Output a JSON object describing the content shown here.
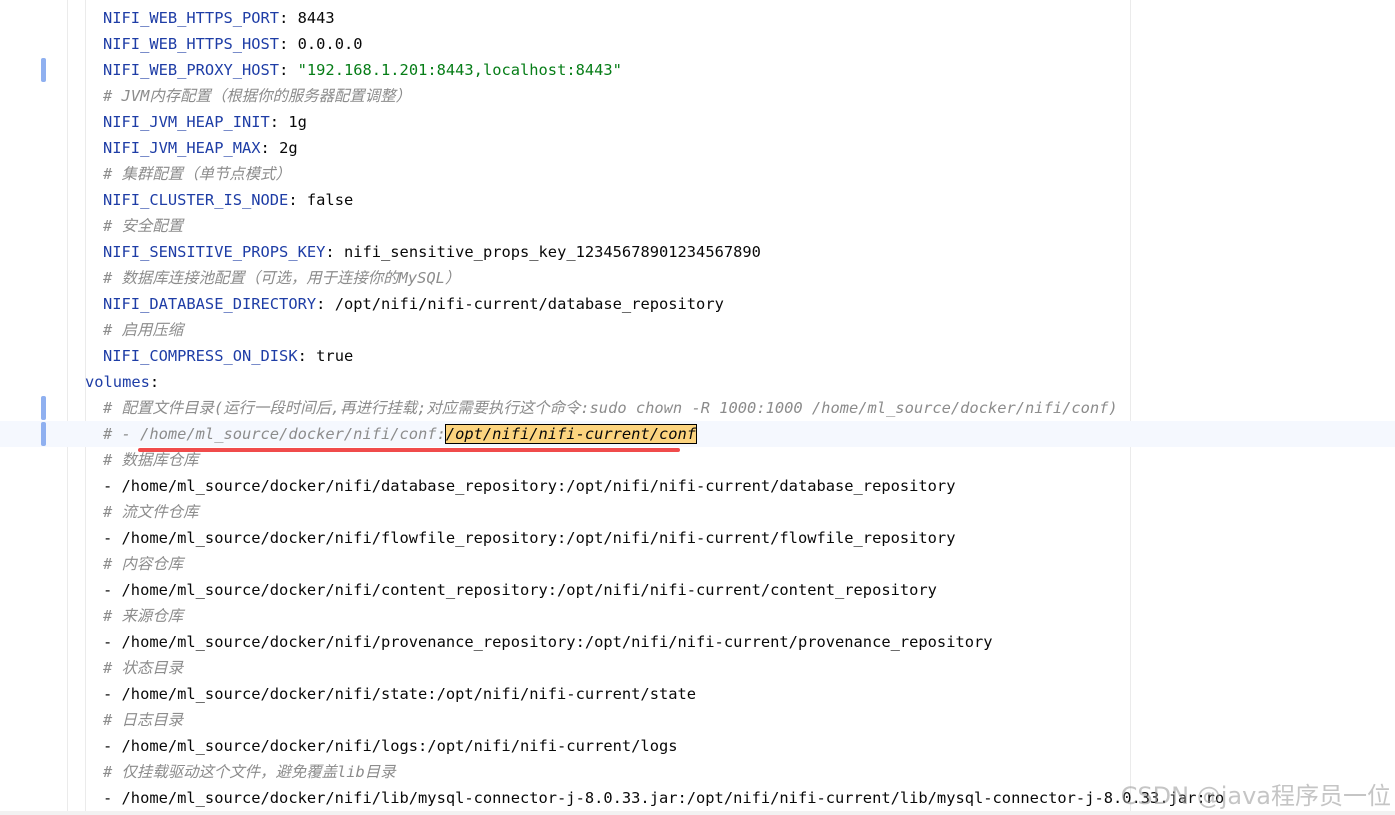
{
  "editor": {
    "lines": [
      {
        "indent": 2,
        "key": "NIFI_WEB_HTTPS_PORT",
        "value": "8443"
      },
      {
        "indent": 2,
        "key": "NIFI_WEB_HTTPS_HOST",
        "value": "0.0.0.0"
      },
      {
        "indent": 2,
        "key": "NIFI_WEB_PROXY_HOST",
        "string": "\"192.168.1.201:8443,localhost:8443\"",
        "changed": true
      },
      {
        "indent": 2,
        "comment": "# JVM内存配置（根据你的服务器配置调整）"
      },
      {
        "indent": 2,
        "key": "NIFI_JVM_HEAP_INIT",
        "value": "1g"
      },
      {
        "indent": 2,
        "key": "NIFI_JVM_HEAP_MAX",
        "value": "2g"
      },
      {
        "indent": 2,
        "comment": "# 集群配置（单节点模式）"
      },
      {
        "indent": 2,
        "key": "NIFI_CLUSTER_IS_NODE",
        "value": "false"
      },
      {
        "indent": 2,
        "comment": "# 安全配置"
      },
      {
        "indent": 2,
        "key": "NIFI_SENSITIVE_PROPS_KEY",
        "value": "nifi_sensitive_props_key_12345678901234567890"
      },
      {
        "indent": 2,
        "comment": "# 数据库连接池配置（可选，用于连接你的MySQL）"
      },
      {
        "indent": 2,
        "key": "NIFI_DATABASE_DIRECTORY",
        "value": "/opt/nifi/nifi-current/database_repository"
      },
      {
        "indent": 2,
        "comment": "# 启用压缩"
      },
      {
        "indent": 2,
        "key": "NIFI_COMPRESS_ON_DISK",
        "value": "true"
      },
      {
        "indent": 1,
        "key": "volumes",
        "value": ""
      },
      {
        "indent": 2,
        "comment": "# 配置文件目录(运行一段时间后,再进行挂载;对应需要执行这个命令:sudo chown -R 1000:1000 /home/ml_source/docker/nifi/conf)",
        "changed": true
      },
      {
        "indent": 2,
        "comment": "# - /home/ml_source/docker/nifi/conf:",
        "highlight": "/opt/nifi/nifi-current/conf",
        "current": true,
        "changed": true
      },
      {
        "indent": 2,
        "comment": "# 数据库仓库"
      },
      {
        "indent": 2,
        "text": "- /home/ml_source/docker/nifi/database_repository:/opt/nifi/nifi-current/database_repository"
      },
      {
        "indent": 2,
        "comment": "# 流文件仓库"
      },
      {
        "indent": 2,
        "text": "- /home/ml_source/docker/nifi/flowfile_repository:/opt/nifi/nifi-current/flowfile_repository"
      },
      {
        "indent": 2,
        "comment": "# 内容仓库"
      },
      {
        "indent": 2,
        "text": "- /home/ml_source/docker/nifi/content_repository:/opt/nifi/nifi-current/content_repository"
      },
      {
        "indent": 2,
        "comment": "# 来源仓库"
      },
      {
        "indent": 2,
        "text": "- /home/ml_source/docker/nifi/provenance_repository:/opt/nifi/nifi-current/provenance_repository"
      },
      {
        "indent": 2,
        "comment": "# 状态目录"
      },
      {
        "indent": 2,
        "text": "- /home/ml_source/docker/nifi/state:/opt/nifi/nifi-current/state"
      },
      {
        "indent": 2,
        "comment": "# 日志目录"
      },
      {
        "indent": 2,
        "text": "- /home/ml_source/docker/nifi/logs:/opt/nifi/nifi-current/logs"
      },
      {
        "indent": 2,
        "comment": "# 仅挂载驱动这个文件，避免覆盖lib目录"
      },
      {
        "indent": 2,
        "text": "- /home/ml_source/docker/nifi/lib/mysql-connector-j-8.0.33.jar:/opt/nifi/nifi-current/lib/mysql-connector-j-8.0.33.jar:ro"
      }
    ]
  },
  "watermark": "CSDN @java程序员一位",
  "colors": {
    "key": "#1e3da6",
    "string": "#067d17",
    "comment": "#8c8c8c",
    "highlight": "#fcd47f",
    "underline": "#f04b4b",
    "current_line": "#f5f8fe"
  }
}
